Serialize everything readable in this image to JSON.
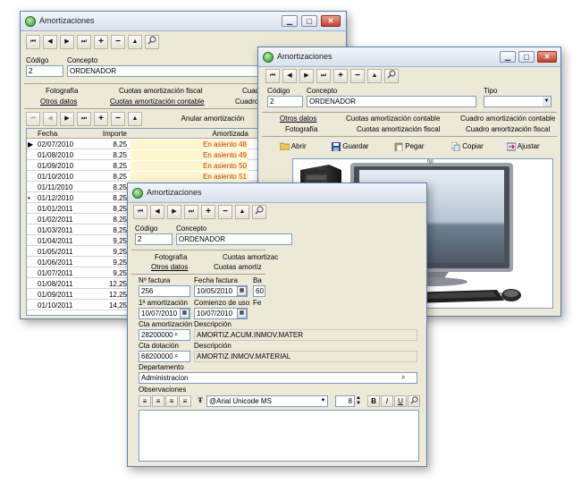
{
  "app_title": "Amortizaciones",
  "nav_buttons": [
    "⏮",
    "◀",
    "▶",
    "⏭",
    "+",
    "−",
    "▲",
    "search-icon"
  ],
  "fields": {
    "codigo_label": "Código",
    "concepto_label": "Concepto",
    "tipo_label": "Tipo",
    "codigo_value": "2",
    "concepto_value": "ORDENADOR"
  },
  "tabs": {
    "fotografia": "Fotografía",
    "cuotas_fiscal": "Cuotas amortización fiscal",
    "cuadro": "Cuadro amortización",
    "cuadro_fiscal": "Cuadro amortización fiscal",
    "otros": "Otros datos",
    "cuotas_contable": "Cuotas amortización contable",
    "cuadro_contable": "Cuadro amortización contable",
    "cuadro_short": "Cuadr",
    "cuadro_short2": "Cuadro",
    "cuotas_amortizac": "Cuotas amortizac",
    "cuotas_short": "Cuotas amortiz"
  },
  "win1": {
    "anular": "Anular amortización",
    "columns": [
      "Fecha",
      "Importe",
      "Amortizada"
    ],
    "rows": [
      {
        "fecha": "02/07/2010",
        "importe": "8,25",
        "amort": "En asiento 48",
        "marker": "▶"
      },
      {
        "fecha": "01/08/2010",
        "importe": "8,25",
        "amort": "En asiento 49",
        "marker": ""
      },
      {
        "fecha": "01/09/2010",
        "importe": "8,25",
        "amort": "En asiento 50",
        "marker": ""
      },
      {
        "fecha": "01/10/2010",
        "importe": "8,25",
        "amort": "En asiento 51",
        "marker": ""
      },
      {
        "fecha": "01/11/2010",
        "importe": "8,25",
        "amort": "",
        "marker": ""
      },
      {
        "fecha": "01/12/2010",
        "importe": "8,25",
        "amort": "",
        "marker": "•"
      },
      {
        "fecha": "01/01/2011",
        "importe": "8,25",
        "amort": "",
        "marker": ""
      },
      {
        "fecha": "01/02/2011",
        "importe": "8,25",
        "amort": "",
        "marker": ""
      },
      {
        "fecha": "01/03/2011",
        "importe": "8,25",
        "amort": "",
        "marker": ""
      },
      {
        "fecha": "01/04/2011",
        "importe": "9,25",
        "amort": "",
        "marker": ""
      },
      {
        "fecha": "01/05/2011",
        "importe": "9,25",
        "amort": "",
        "marker": ""
      },
      {
        "fecha": "01/06/2011",
        "importe": "9,25",
        "amort": "",
        "marker": ""
      },
      {
        "fecha": "01/07/2011",
        "importe": "9,25",
        "amort": "",
        "marker": ""
      },
      {
        "fecha": "01/08/2011",
        "importe": "12,25",
        "amort": "",
        "marker": ""
      },
      {
        "fecha": "01/09/2011",
        "importe": "12,25",
        "amort": "",
        "marker": ""
      },
      {
        "fecha": "01/10/2011",
        "importe": "14,25",
        "amort": "",
        "marker": ""
      }
    ]
  },
  "win2": {
    "buttons": {
      "abrir": "Abrir",
      "guardar": "Guardar",
      "pegar": "Pegar",
      "copiar": "Copiar",
      "ajustar": "Ajustar"
    },
    "tipo_value": "",
    "monitor_brand": "hp"
  },
  "win3": {
    "n_factura_label": "Nº factura",
    "fecha_factura_label": "Fecha factura",
    "ba_label": "Ba",
    "n_factura_value": "256",
    "fecha_factura_value": "10/05/2010",
    "ba_value": "60",
    "primera_amort_label": "1ª amortización",
    "comienzo_label": "Comienzo de uso",
    "fe_label": "Fe",
    "primera_amort_value": "10/07/2010",
    "comienzo_value": "10/07/2010",
    "cta_amort_label": "Cta amortización",
    "descripcion_label": "Descripción",
    "cta_amort_value": "28200000",
    "cta_amort_desc": "AMORTIZ.ACUM.INMOV.MATER",
    "cta_dot_label": "Cta dotación",
    "cta_dot_value": "68200000",
    "cta_dot_desc": "AMORTIZ.INMOV.MATERIAL",
    "departamento_label": "Departamento",
    "departamento_value": "Administracion",
    "observaciones_label": "Observaciones",
    "font_name": "@Arial Unicode MS",
    "font_size": "8",
    "bold": "B",
    "italic": "I",
    "underline": "U"
  },
  "colors": {
    "accent": "#c23c12",
    "highlight": "#fdf6cf",
    "title_bar": "#d7e1ee"
  }
}
